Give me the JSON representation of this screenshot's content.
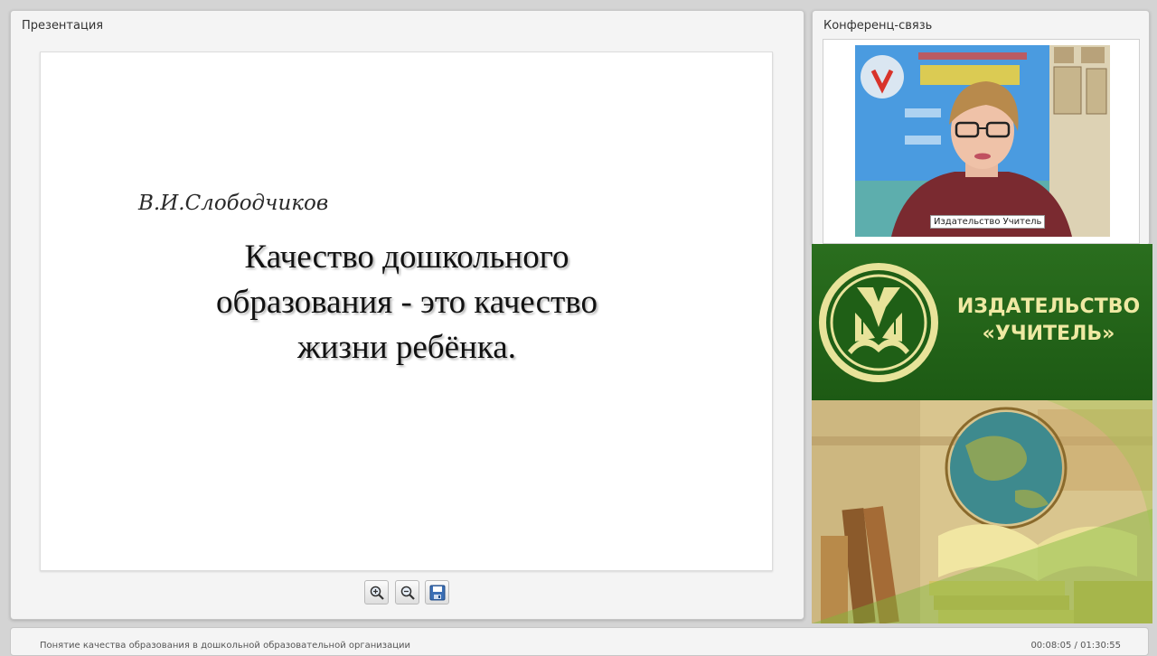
{
  "presentation_panel": {
    "title": "Презентация",
    "slide": {
      "author": "В.И.Слободчиков",
      "quote": "Качество дошкольного образования - это качество жизни ребёнка."
    },
    "toolbar": {
      "zoom_in_icon": "zoom-in-icon",
      "zoom_out_icon": "zoom-out-icon",
      "save_icon": "save-icon"
    }
  },
  "conference_panel": {
    "title": "Конференц-связь",
    "video_label": "Издательство Учитель"
  },
  "logo_banner": {
    "name_line1": "ИЗДАТЕЛЬСТВО",
    "name_line2": "«УЧИТЕЛЬ»"
  },
  "footer": {
    "lecture_title": "Понятие качества образования в дошкольной образовательной организации",
    "timecode": "00:08:05 / 01:30:55"
  },
  "colors": {
    "banner_green": "#1d5a14",
    "banner_text": "#efe9a3",
    "panel_bg": "#f4f4f4"
  }
}
